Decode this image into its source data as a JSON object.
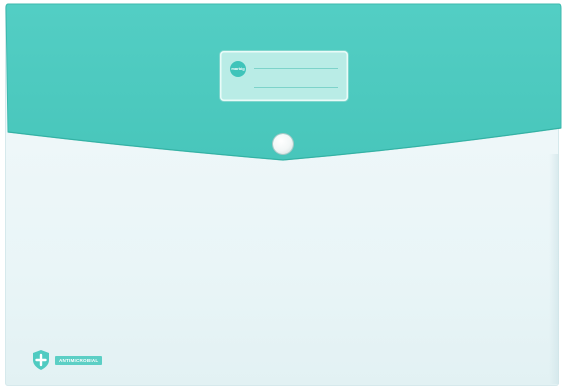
{
  "product": {
    "type": "document folder with snap button",
    "colors": {
      "flap": "#4fcbc1",
      "body": "#e8f5f7",
      "label_card": "#b9ece6",
      "accent": "#3fc4ba"
    }
  },
  "label": {
    "logo_text": "marbig"
  },
  "badge": {
    "icon": "shield-cross-icon",
    "text": "ANTIMICROBIAL"
  }
}
